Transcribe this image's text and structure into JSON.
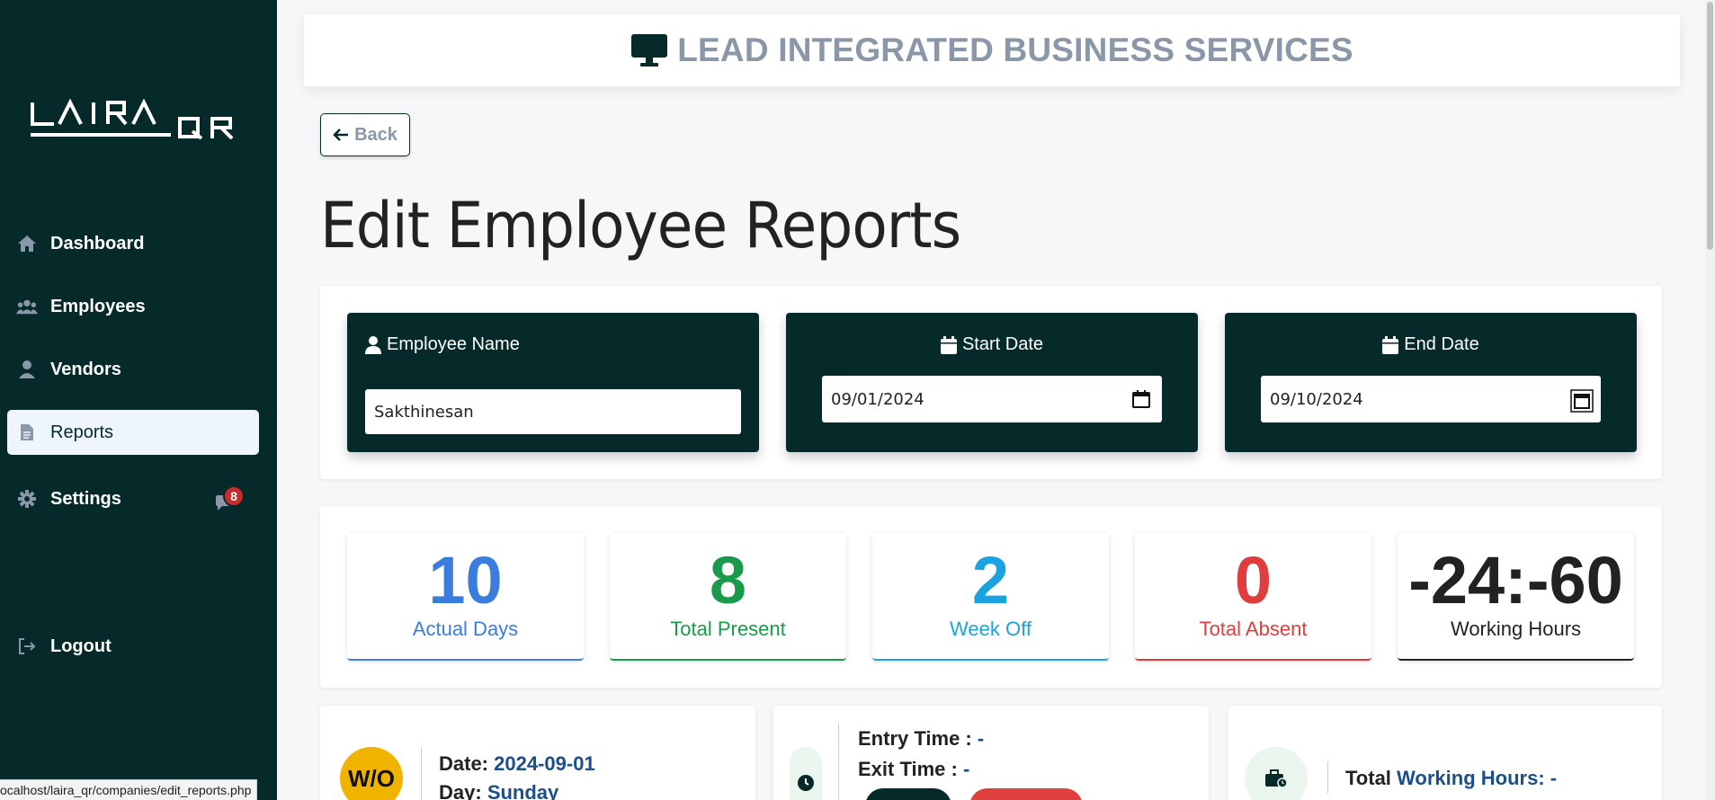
{
  "sidebar": {
    "logo_text": "LAIRA QR",
    "items": [
      {
        "label": "Dashboard"
      },
      {
        "label": "Employees"
      },
      {
        "label": "Vendors"
      },
      {
        "label": "Reports"
      },
      {
        "label": "Settings"
      },
      {
        "label": "Logout"
      }
    ],
    "notification_count": "8",
    "status_url": "ocalhost/laira_qr/companies/edit_reports.php"
  },
  "header": {
    "title": "LEAD INTEGRATED BUSINESS SERVICES"
  },
  "back_label": "Back",
  "page_title": "Edit Employee Reports",
  "filters": {
    "employee_label": "Employee Name",
    "employee_value": "Sakthinesan",
    "start_label": "Start Date",
    "start_value": "09/01/2024",
    "end_label": "End Date",
    "end_value": "09/10/2024"
  },
  "stats": [
    {
      "value": "10",
      "label": "Actual Days",
      "color": "#3b7ddd"
    },
    {
      "value": "8",
      "label": "Total Present",
      "color": "#1a9a4b"
    },
    {
      "value": "2",
      "label": "Week Off",
      "color": "#1aa3e0"
    },
    {
      "value": "0",
      "label": "Total Absent",
      "color": "#e03e3e"
    },
    {
      "value": "-24:-60",
      "label": "Working Hours",
      "color": "#222222"
    }
  ],
  "day_card": {
    "badge": "W/O",
    "date_label": "Date:",
    "date_value": "2024-09-01",
    "day_label": "Day:",
    "day_value": "Sunday"
  },
  "time_card": {
    "entry_label": "Entry Time :",
    "entry_value": "-",
    "exit_label": "Exit Time :",
    "exit_value": "-"
  },
  "hours_card": {
    "label_prefix": "Total",
    "label_highlight": "Working Hours:",
    "value": "-"
  }
}
